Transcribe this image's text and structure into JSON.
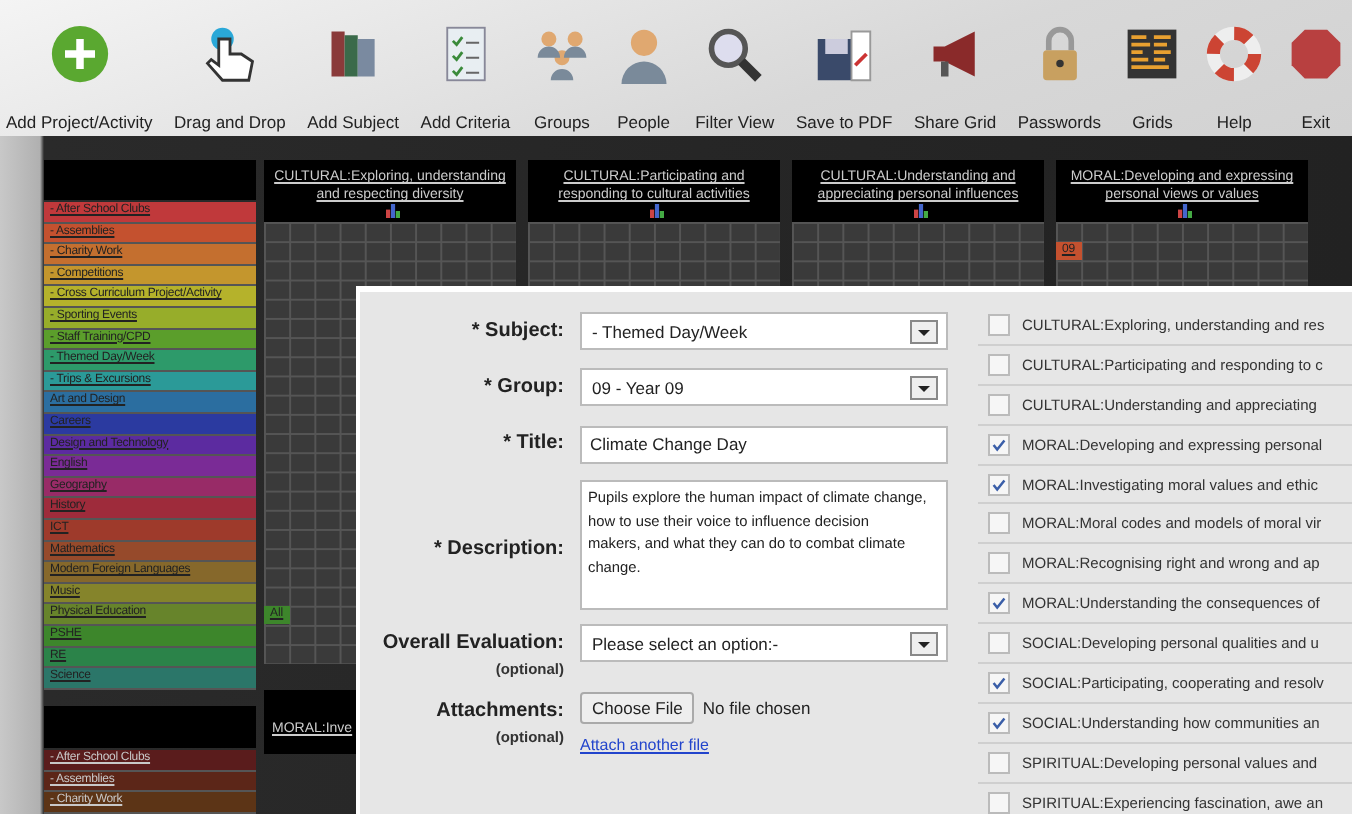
{
  "toolbar": [
    {
      "label": "Add Project/Activity"
    },
    {
      "label": "Drag and Drop"
    },
    {
      "label": "Add Subject"
    },
    {
      "label": "Add Criteria"
    },
    {
      "label": "Groups"
    },
    {
      "label": "People"
    },
    {
      "label": "Filter View"
    },
    {
      "label": "Save to PDF"
    },
    {
      "label": "Share Grid"
    },
    {
      "label": "Passwords"
    },
    {
      "label": "Grids"
    },
    {
      "label": "Help"
    },
    {
      "label": "Exit"
    }
  ],
  "grid": {
    "columns": [
      {
        "label": "CULTURAL:Exploring, understanding and respecting diversity"
      },
      {
        "label": "CULTURAL:Participating and responding to cultural activities"
      },
      {
        "label": "CULTURAL:Understanding and appreciating personal influences"
      },
      {
        "label": "MORAL:Developing and expressing personal views or values"
      }
    ],
    "subjects": [
      {
        "label": "- After School Clubs",
        "color": "#c0393b"
      },
      {
        "label": "- Assemblies",
        "color": "#c4512f",
        "cells": [
          null,
          null,
          null,
          "09"
        ]
      },
      {
        "label": "- Charity Work",
        "color": "#c46f2f"
      },
      {
        "label": "- Competitions",
        "color": "#c4962d"
      },
      {
        "label": "- Cross Curriculum Project/Activity",
        "color": "#b5b22b"
      },
      {
        "label": "- Sporting Events",
        "color": "#97ad2a"
      },
      {
        "label": "- Staff Training/CPD",
        "color": "#5b9e2b"
      },
      {
        "label": "- Themed Day/Week",
        "color": "#2d9a6a"
      },
      {
        "label": "- Trips & Excursions",
        "color": "#2b9a98"
      },
      {
        "label": "Art and Design",
        "color": "#2b6ea0"
      },
      {
        "label": "Careers",
        "color": "#2b3aa0"
      },
      {
        "label": "Design and Technology",
        "color": "#5c2ba0"
      },
      {
        "label": "English",
        "color": "#7a2b96"
      },
      {
        "label": "Geography",
        "color": "#982b67"
      },
      {
        "label": "History",
        "color": "#9e2b3b"
      },
      {
        "label": "ICT",
        "color": "#9e3a2b"
      },
      {
        "label": "Mathematics",
        "color": "#964a2b"
      },
      {
        "label": "Modern Foreign Languages",
        "color": "#86682b"
      },
      {
        "label": "Music",
        "color": "#85842b"
      },
      {
        "label": "Physical Education",
        "color": "#67842b"
      },
      {
        "label": "PSHE",
        "color": "#3d862b",
        "cells": [
          "All"
        ]
      },
      {
        "label": "RE",
        "color": "#2b8349"
      },
      {
        "label": "Science",
        "color": "#2b7669"
      }
    ]
  },
  "lower_grid": {
    "column_label": "MORAL:Inve",
    "subjects": [
      {
        "label": "- After School Clubs",
        "color": "#5a1c1c"
      },
      {
        "label": "- Assemblies",
        "color": "#5c2618"
      },
      {
        "label": "- Charity Work",
        "color": "#5c3416"
      }
    ]
  },
  "dialog": {
    "form": [
      {
        "kind": "select",
        "label": "* Subject:",
        "value": "- Themed Day/Week"
      },
      {
        "kind": "select",
        "label": "* Group:",
        "value": "09 - Year 09"
      },
      {
        "kind": "text",
        "label": "* Title:",
        "value": "Climate Change Day"
      },
      {
        "kind": "textarea",
        "label": "* Description:",
        "value": "Pupils explore the human impact of climate change, how to use their voice to influence decision\nmakers, and what they can do to combat climate change."
      },
      {
        "kind": "select",
        "label": "Overall Evaluation:",
        "note": "(optional)",
        "value": "Please select an option:-"
      },
      {
        "kind": "file",
        "label": "Attachments:",
        "note": "(optional)",
        "button": "Choose File",
        "status": "No file chosen",
        "link": "Attach another file"
      }
    ],
    "criteria": [
      {
        "label": "CULTURAL:Exploring, understanding and res",
        "checked": false
      },
      {
        "label": "CULTURAL:Participating and responding to c",
        "checked": false
      },
      {
        "label": "CULTURAL:Understanding and appreciating",
        "checked": false
      },
      {
        "label": "MORAL:Developing and expressing personal",
        "checked": true
      },
      {
        "label": "MORAL:Investigating moral values and ethic",
        "checked": true
      },
      {
        "label": "MORAL:Moral codes and models of moral vir",
        "checked": false
      },
      {
        "label": "MORAL:Recognising right and wrong and ap",
        "checked": false
      },
      {
        "label": "MORAL:Understanding the consequences of",
        "checked": true
      },
      {
        "label": "SOCIAL:Developing personal qualities and u",
        "checked": false
      },
      {
        "label": "SOCIAL:Participating, cooperating and resolv",
        "checked": true
      },
      {
        "label": "SOCIAL:Understanding how communities an",
        "checked": true
      },
      {
        "label": "SPIRITUAL:Developing personal values and",
        "checked": false
      },
      {
        "label": "SPIRITUAL:Experiencing fascination, awe an",
        "checked": false
      }
    ]
  }
}
